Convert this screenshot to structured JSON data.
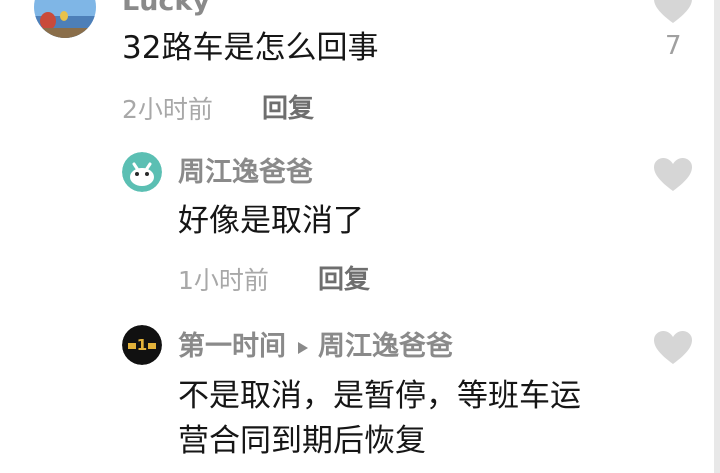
{
  "comments": [
    {
      "username": "Lucky",
      "content": "32路车是怎么回事",
      "time": "2小时前",
      "reply_label": "回复",
      "like_count": "7"
    },
    {
      "username": "周江逸爸爸",
      "content": "好像是取消了",
      "time": "1小时前",
      "reply_label": "回复"
    },
    {
      "username": "第一时间",
      "reply_to": "周江逸爸爸",
      "content_line1": "不是取消，是暂停，等班车运",
      "content_line2": "营合同到期后恢复"
    }
  ],
  "icons": {
    "like": "heart-icon",
    "reply_arrow": "triangle-right-icon"
  },
  "colors": {
    "heart": "#d6d6d6",
    "username": "#8a8a8a",
    "content": "#161616",
    "meta": "#a8a8a8"
  }
}
